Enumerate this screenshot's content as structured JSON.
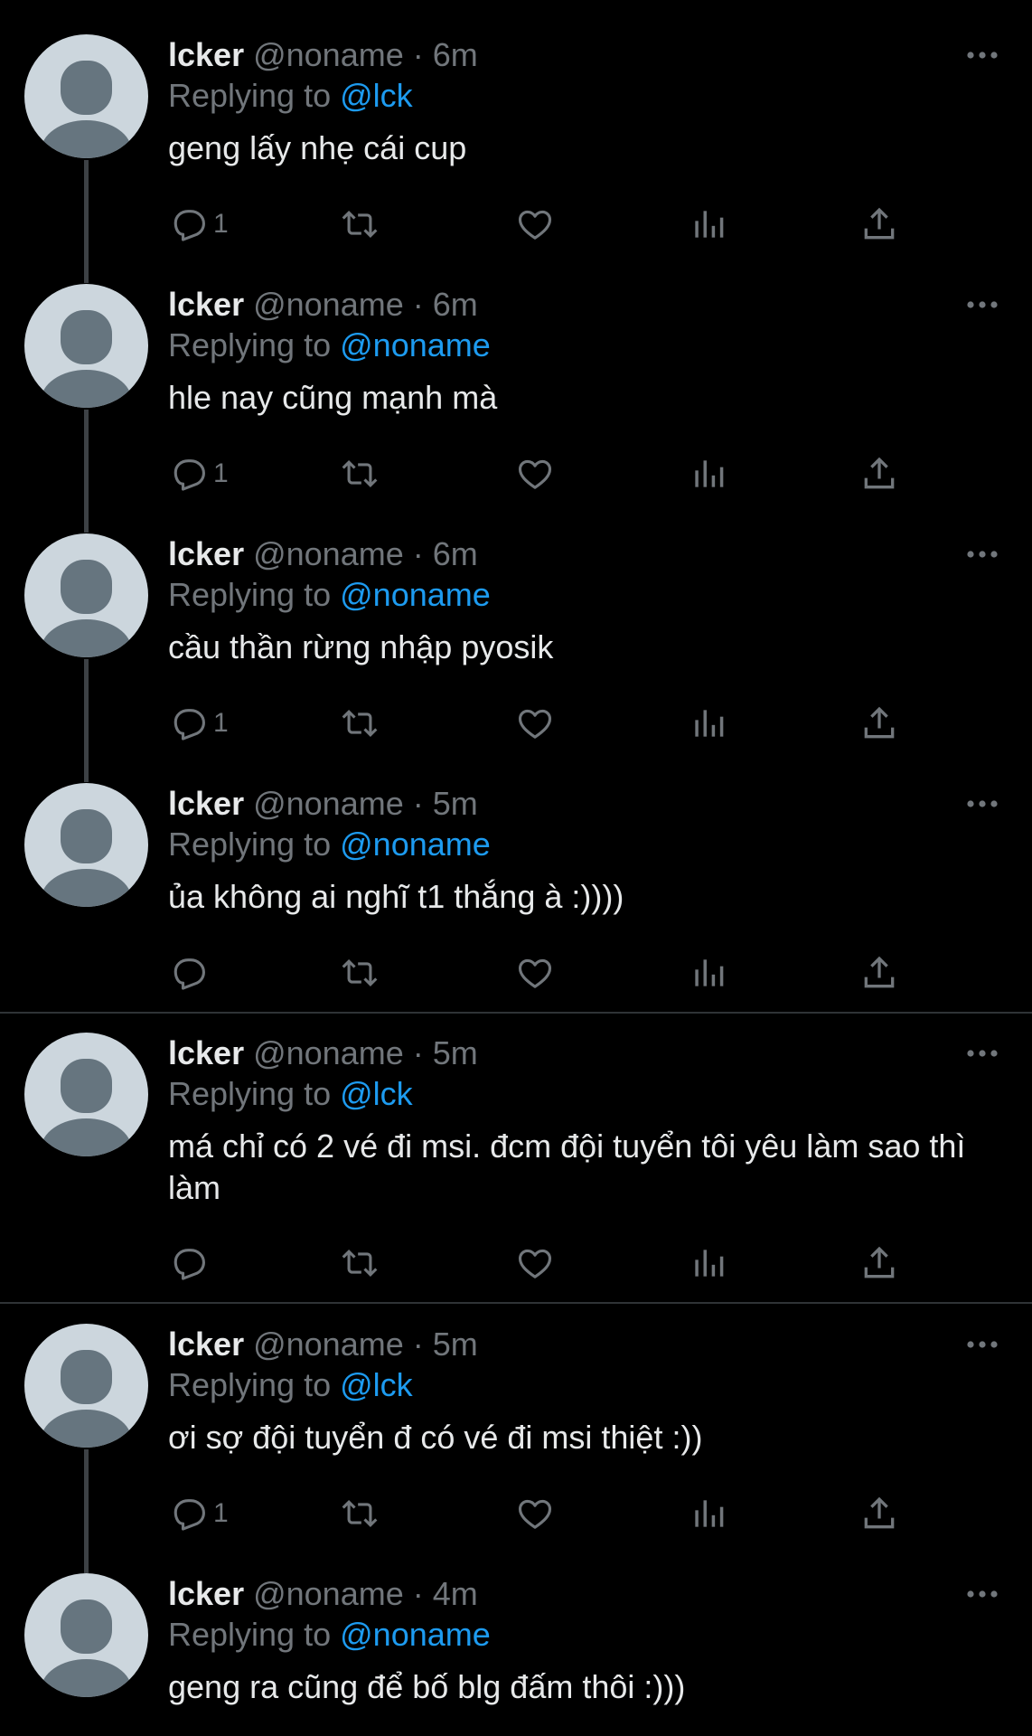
{
  "tweets": [
    {
      "name": "lcker",
      "handle": "@noname",
      "time": "6m",
      "replying_label": "Replying to",
      "replying_to": "@lck",
      "text": "geng lấy nhẹ cái cup",
      "reply_count": "1"
    },
    {
      "name": "lcker",
      "handle": "@noname",
      "time": "6m",
      "replying_label": "Replying to",
      "replying_to": "@noname",
      "text": "hle nay cũng mạnh mà",
      "reply_count": "1"
    },
    {
      "name": "lcker",
      "handle": "@noname",
      "time": "6m",
      "replying_label": "Replying to",
      "replying_to": "@noname",
      "text": "cầu thần rừng nhập pyosik",
      "reply_count": "1"
    },
    {
      "name": "lcker",
      "handle": "@noname",
      "time": "5m",
      "replying_label": "Replying to",
      "replying_to": "@noname",
      "text": "ủa không ai nghĩ t1 thắng à :))))",
      "reply_count": ""
    },
    {
      "name": "lcker",
      "handle": "@noname",
      "time": "5m",
      "replying_label": "Replying to",
      "replying_to": "@lck",
      "text": "má chỉ có 2 vé đi msi. đcm đội tuyển tôi yêu làm sao thì làm",
      "reply_count": ""
    },
    {
      "name": "lcker",
      "handle": "@noname",
      "time": "5m",
      "replying_label": "Replying to",
      "replying_to": "@lck",
      "text": "ơi sợ đội tuyển đ có vé đi msi thiệt :))",
      "reply_count": "1"
    },
    {
      "name": "lcker",
      "handle": "@noname",
      "time": "4m",
      "replying_label": "Replying to",
      "replying_to": "@noname",
      "text": "geng ra cũng để bố blg đấm thôi :)))",
      "reply_count": ""
    }
  ],
  "separator": "·",
  "icons": {
    "reply": "reply-icon",
    "retweet": "retweet-icon",
    "like": "heart-icon",
    "views": "views-icon",
    "share": "share-icon",
    "more": "more-icon"
  },
  "colors": {
    "background": "#000000",
    "text": "#e7e9ea",
    "secondary": "#71767b",
    "link": "#1d9bf0",
    "thread_line": "#3d4145",
    "divider": "#2f3336"
  }
}
